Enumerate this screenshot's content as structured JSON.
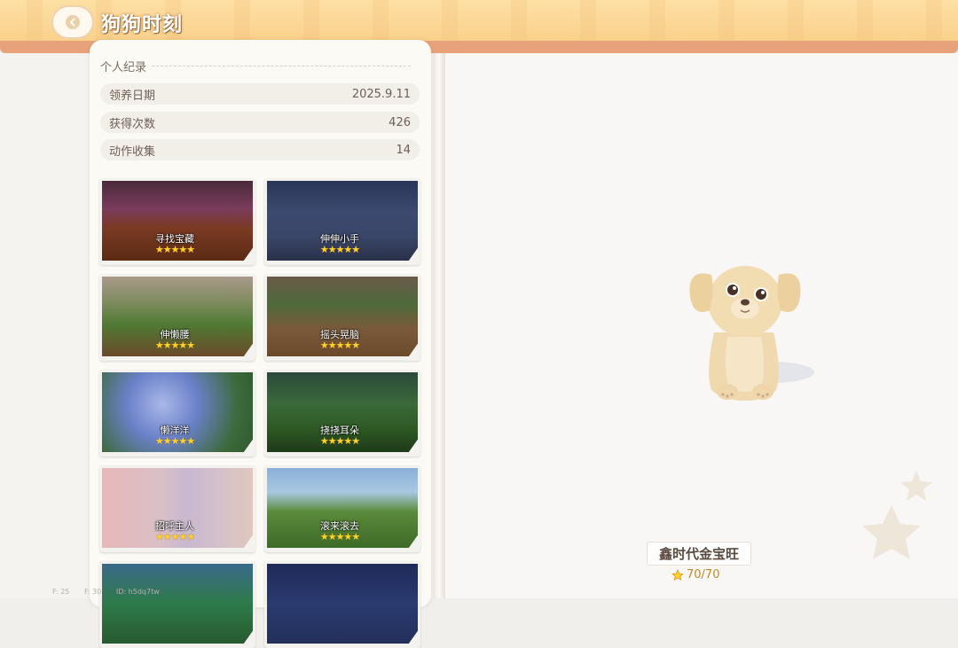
{
  "header": {
    "title": "狗狗时刻"
  },
  "record": {
    "section_title": "个人纪录",
    "stats": [
      {
        "label": "领养日期",
        "value": "2025.9.11"
      },
      {
        "label": "获得次数",
        "value": "426"
      },
      {
        "label": "动作收集",
        "value": "14"
      }
    ]
  },
  "actions": [
    {
      "name": "寻找宝藏",
      "stars": "★★★★★",
      "rating": 5
    },
    {
      "name": "伸伸小手",
      "stars": "★★★★★",
      "rating": 5
    },
    {
      "name": "伸懒腰",
      "stars": "★★★★★",
      "rating": 5
    },
    {
      "name": "摇头晃脑",
      "stars": "★★★★★",
      "rating": 5
    },
    {
      "name": "懒洋洋",
      "stars": "★★★★★",
      "rating": 5
    },
    {
      "name": "挠挠耳朵",
      "stars": "★★★★★",
      "rating": 5
    },
    {
      "name": "招呼主人",
      "stars": "★★★★★",
      "rating": 5
    },
    {
      "name": "滚来滚去",
      "stars": "★★★★★",
      "rating": 5
    },
    {
      "name": "",
      "stars": "",
      "rating": 0
    },
    {
      "name": "",
      "stars": "",
      "rating": 0
    }
  ],
  "dog": {
    "name": "鑫时代金宝旺",
    "score": "70/70"
  },
  "debug": {
    "f1": "F: 25",
    "f2": "F: 30",
    "id": "ID: h5dq7tw"
  },
  "colors": {
    "banner": "#f9cf88",
    "accent": "#e8a27a",
    "star": "#ffd12b"
  }
}
